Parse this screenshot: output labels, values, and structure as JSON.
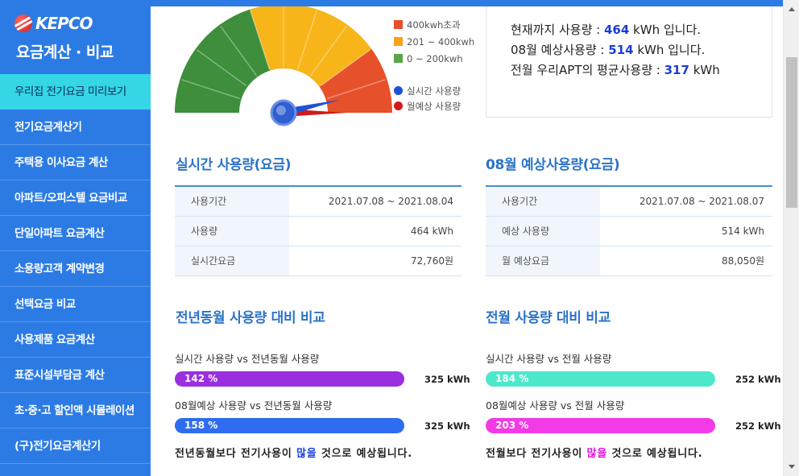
{
  "brand": "KEPCO",
  "app_title": "요금계산 · 비교",
  "menu": [
    {
      "label": "우리집 전기요금 미리보기",
      "active": true
    },
    {
      "label": "전기요금계산기"
    },
    {
      "label": "주택용 이사요금 계산"
    },
    {
      "label": "아파트/오피스텔 요금비교"
    },
    {
      "label": "단일아파트 요금계산"
    },
    {
      "label": "소용량고객 계약변경"
    },
    {
      "label": "선택요금 비교"
    },
    {
      "label": "사용제품 요금계산"
    },
    {
      "label": "표준시설부담금 계산"
    },
    {
      "label": "초·중·고 할인액 시뮬레이션"
    },
    {
      "label": "(구)전기요금계산기"
    }
  ],
  "gauge": {
    "max_kwh": 500,
    "realtime_kwh": 464,
    "projected_kwh": 514,
    "legend": {
      "over400": "400kwh초과",
      "mid": "201 ~ 400kwh",
      "low": "0 ~ 200kwh",
      "realtime": "실시간 사용량",
      "projected": "월예상 사용량"
    },
    "colors": {
      "low": "#3e8e3c",
      "mid": "#f7b51a",
      "high": "#e6502a",
      "realtime": "#1c53d6",
      "projected": "#d11a1a"
    }
  },
  "summary": {
    "line1_prefix": "현재까지 사용량 : ",
    "line1_value": "464",
    "line1_suffix": " kWh 입니다.",
    "line2_prefix": "08월 예상사용량 : ",
    "line2_value": "514",
    "line2_suffix": " kWh 입니다.",
    "line3_prefix": "전월 우리APT의 평균사용량 : ",
    "line3_value": "317",
    "line3_suffix": " kWh"
  },
  "realtime": {
    "title": "실시간 사용량(요금)",
    "rows": [
      {
        "label": "사용기간",
        "value": "2021.07.08 ~ 2021.08.04"
      },
      {
        "label": "사용량",
        "value": "464 kWh"
      },
      {
        "label": "실시간요금",
        "value": "72,760원"
      }
    ]
  },
  "projected": {
    "title": "08월 예상사용량(요금)",
    "rows": [
      {
        "label": "사용기간",
        "value": "2021.07.08 ~ 2021.08.07"
      },
      {
        "label": "예상 사용량",
        "value": "514 kWh"
      },
      {
        "label": "월 예상요금",
        "value": "88,050원"
      }
    ]
  },
  "yoy": {
    "title": "전년동월 사용량 대비 비교",
    "bar1": {
      "label": "실시간 사용량 vs 전년동월 사용량",
      "percent": "142 %",
      "value": "325 kWh",
      "color": "#9b2fe0"
    },
    "bar2": {
      "label": "08월예상 사용량 vs 전년동월 사용량",
      "percent": "158 %",
      "value": "325 kWh",
      "color": "#2f6cf0"
    },
    "verdict_prefix": "전년동월보다 전기사용이 ",
    "verdict_highlight": "많을",
    "verdict_suffix": " 것으로 예상됩니다."
  },
  "mom": {
    "title": "전월 사용량 대비 비교",
    "bar1": {
      "label": "실시간 사용량 vs 전월 사용량",
      "percent": "184 %",
      "value": "252 kWh",
      "color": "#4de8cc"
    },
    "bar2": {
      "label": "08월예상 사용량 vs 전월 사용량",
      "percent": "203 %",
      "value": "252 kWh",
      "color": "#f23ae6"
    },
    "verdict_prefix": "전월보다 전기사용이 ",
    "verdict_highlight": "많을",
    "verdict_suffix": " 것으로 예상됩니다."
  }
}
